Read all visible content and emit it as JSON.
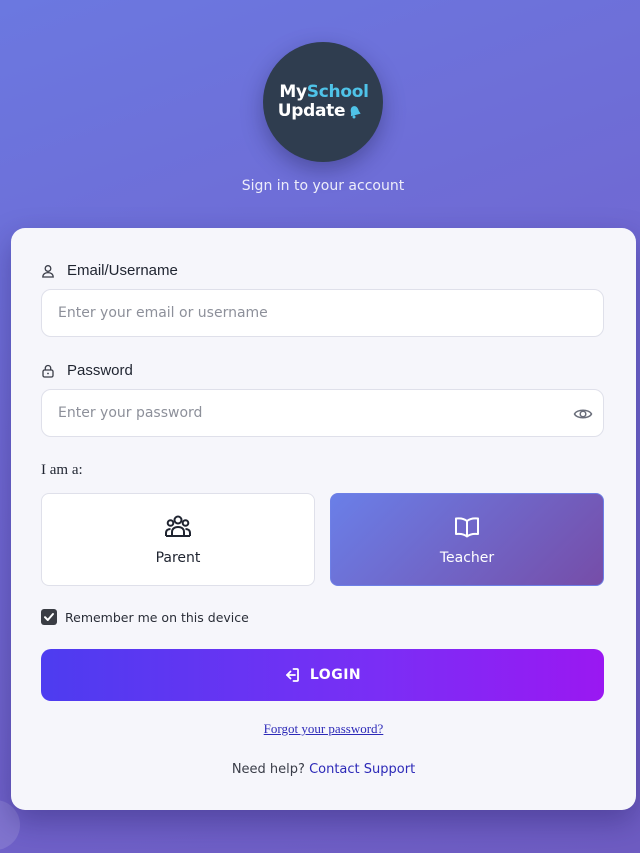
{
  "brand": {
    "logo_part1": "My",
    "logo_part2": "School",
    "logo_line2": "Update",
    "logo_bg": "#2f3d4f",
    "logo_accent": "#4fc3e8"
  },
  "subtitle": "Sign in to your account",
  "email": {
    "label": "Email/Username",
    "placeholder": "Enter your email or username",
    "value": "",
    "icon": "user-icon"
  },
  "password": {
    "label": "Password",
    "placeholder": "Enter your password",
    "value": "",
    "icon": "lock-icon",
    "toggle_icon": "eye-icon"
  },
  "role": {
    "prompt": "I am a:",
    "options": [
      {
        "label": "Parent",
        "icon": "users-icon",
        "selected": false
      },
      {
        "label": "Teacher",
        "icon": "book-icon",
        "selected": true
      }
    ]
  },
  "remember": {
    "label": "Remember me on this device",
    "checked": true
  },
  "login_button": {
    "label": "LOGIN",
    "icon": "login-icon"
  },
  "forgot_link": "Forgot your password?",
  "help": {
    "text": "Need help?",
    "link": "Contact Support"
  },
  "colors": {
    "background_start": "#6b78e0",
    "background_end": "#6e5cc2",
    "card_bg": "#f6f6fb",
    "login_gradient_start": "#4d3cf0",
    "login_gradient_end": "#9a18f2",
    "teacher_gradient_start": "#6a7fe8",
    "teacher_gradient_end": "#764da8",
    "link": "#2d2ab8"
  }
}
